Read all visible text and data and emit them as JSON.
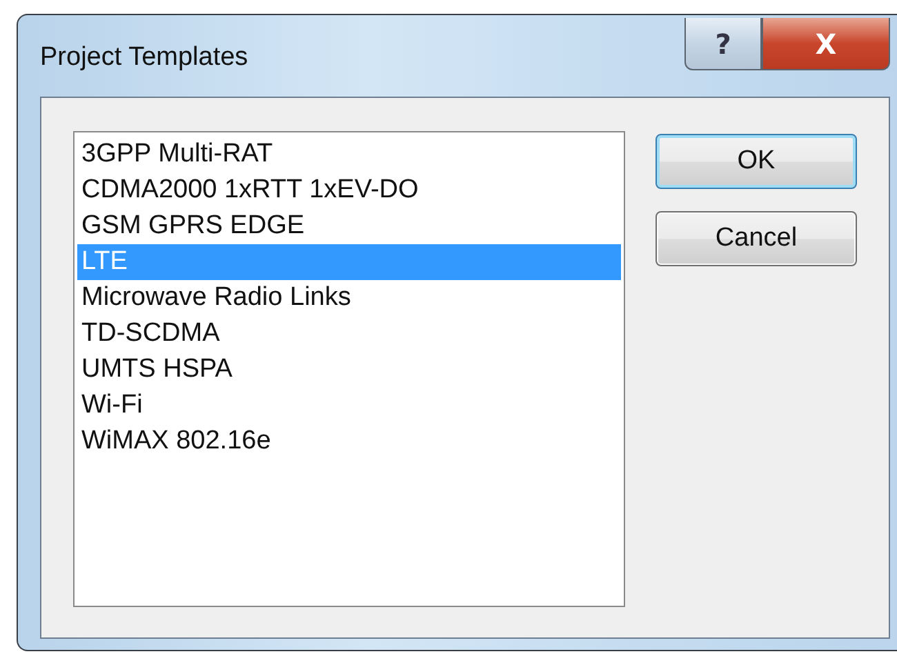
{
  "window": {
    "title": "Project Templates",
    "help_button": "?",
    "close_button": "X"
  },
  "templates": [
    {
      "label": "3GPP Multi-RAT",
      "selected": false
    },
    {
      "label": "CDMA2000 1xRTT 1xEV-DO",
      "selected": false
    },
    {
      "label": "GSM GPRS EDGE",
      "selected": false
    },
    {
      "label": "LTE",
      "selected": true
    },
    {
      "label": "Microwave Radio Links",
      "selected": false
    },
    {
      "label": "TD-SCDMA",
      "selected": false
    },
    {
      "label": "UMTS HSPA",
      "selected": false
    },
    {
      "label": "Wi-Fi",
      "selected": false
    },
    {
      "label": "WiMAX 802.16e",
      "selected": false
    }
  ],
  "buttons": [
    {
      "label": "OK",
      "default": true
    },
    {
      "label": "Cancel",
      "default": false
    }
  ]
}
